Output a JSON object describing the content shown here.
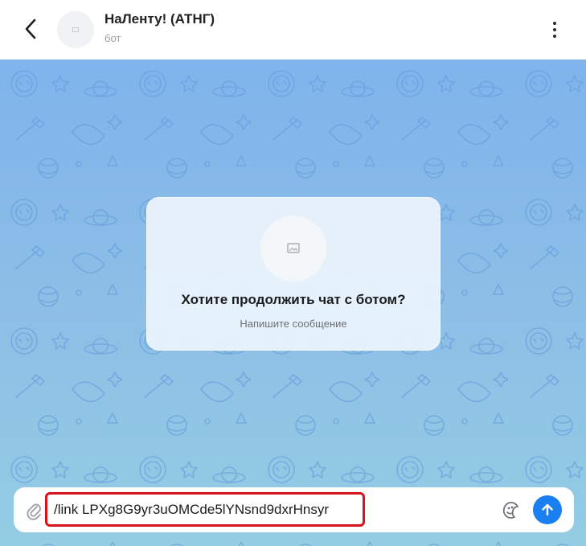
{
  "header": {
    "title": "НаЛенту! (АТНГ)",
    "subtitle": "бот",
    "back_icon": "chevron-left-icon",
    "menu_icon": "more-vertical-icon",
    "avatar_icon": "image-placeholder-icon"
  },
  "chat": {
    "background_colors": [
      "#7fb4ec",
      "#93cde3"
    ],
    "intro": {
      "title": "Хотите продолжить чат с ботом?",
      "subtitle": "Напишите сообщение",
      "icon": "image-placeholder-icon"
    }
  },
  "composer": {
    "input_value": "/link LPXg8G9yr3uOMCde5lYNsnd9dxrHnsyr",
    "attach_icon": "paperclip-icon",
    "sticker_icon": "sticker-icon",
    "send_icon": "arrow-up-icon",
    "highlight_color": "#d9121c",
    "send_color": "#1a7ff0"
  }
}
